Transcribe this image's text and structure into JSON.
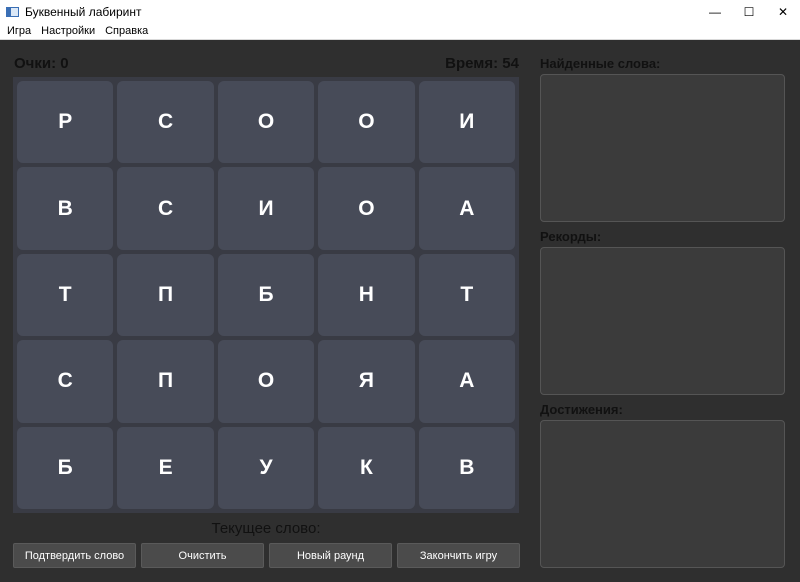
{
  "window": {
    "title": "Буквенный лабиринт",
    "minimize": "—",
    "maximize": "☐",
    "close": "✕"
  },
  "menu": [
    "Игра",
    "Настройки",
    "Справка"
  ],
  "status": {
    "score": "Очки: 0",
    "time": "Время: 54"
  },
  "board": [
    [
      "Р",
      "С",
      "О",
      "О",
      "И"
    ],
    [
      "В",
      "С",
      "И",
      "О",
      "А"
    ],
    [
      "Т",
      "П",
      "Б",
      "Н",
      "Т"
    ],
    [
      "С",
      "П",
      "О",
      "Я",
      "А"
    ],
    [
      "Б",
      "Е",
      "У",
      "К",
      "В"
    ]
  ],
  "current_word_label": "Текущее слово:",
  "buttons": [
    "Подтвердить слово",
    "Очистить",
    "Новый раунд",
    "Закончить игру"
  ],
  "panels": {
    "found": "Найденные слова:",
    "records": "Рекорды:",
    "achievements": "Достижения:"
  }
}
